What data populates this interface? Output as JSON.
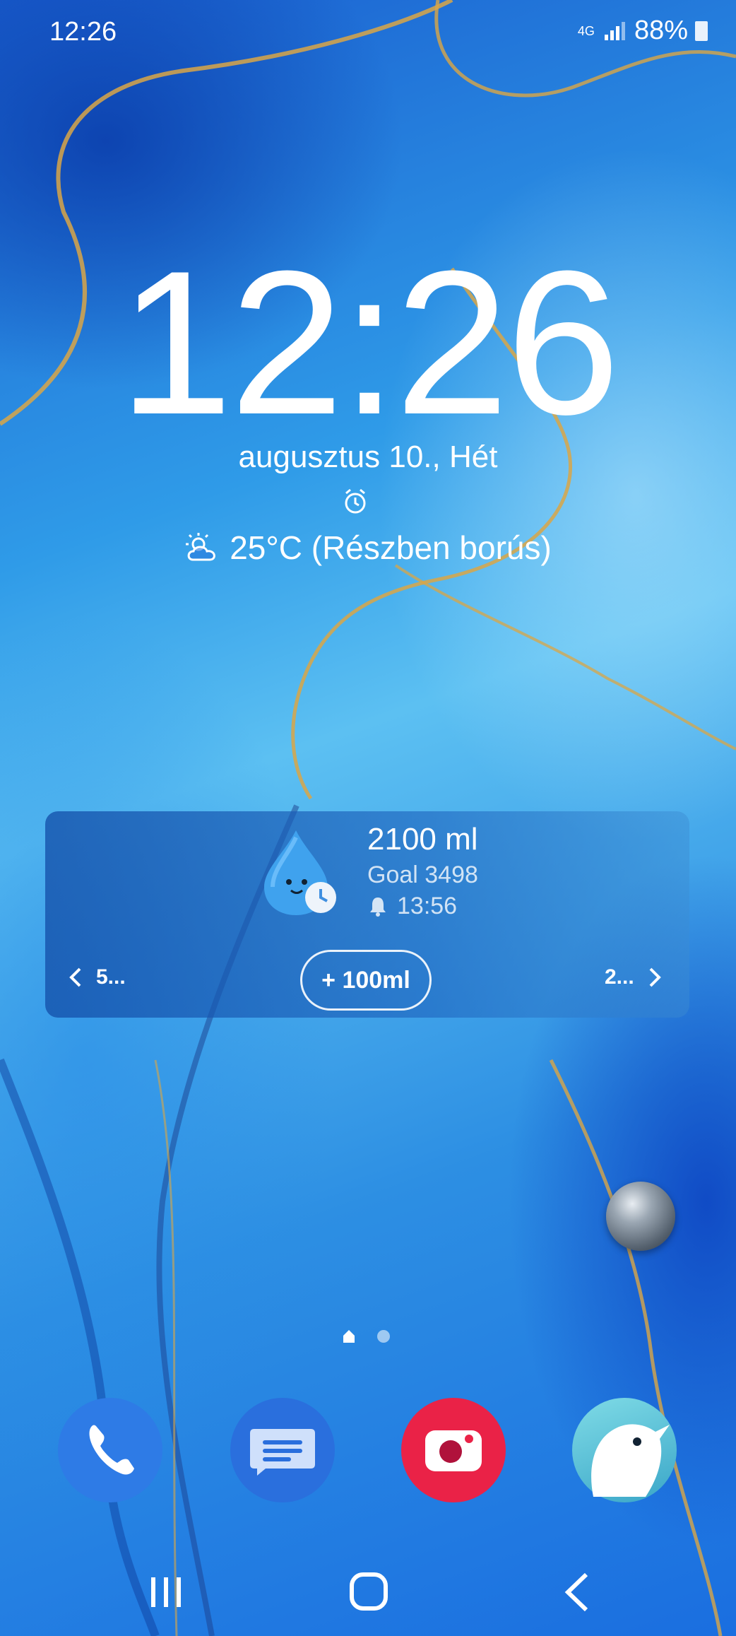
{
  "status_bar": {
    "time": "12:26",
    "network": "4G",
    "battery": "88%"
  },
  "lockscreen": {
    "clock": "12:26",
    "date": "augusztus 10., Hét",
    "weather": "25°C (Részben borús)"
  },
  "water_widget": {
    "amount": "2100 ml",
    "goal": "Goal 3498",
    "reminder_time": "13:56",
    "prev_label": "5...",
    "next_label": "2...",
    "add_button_label": "+ 100ml"
  },
  "dock": {
    "apps": [
      {
        "name": "Phone",
        "icon": "phone-icon",
        "color": "#2e7be6"
      },
      {
        "name": "Messages",
        "icon": "messages-icon",
        "color": "#2a6fdd"
      },
      {
        "name": "Camera",
        "icon": "camera-icon",
        "color": "#ea2247"
      },
      {
        "name": "Kiwi Browser",
        "icon": "kiwi-bird-icon",
        "color": "#58c6d8"
      }
    ]
  },
  "nav": {
    "buttons": [
      "recents",
      "home",
      "back"
    ]
  }
}
